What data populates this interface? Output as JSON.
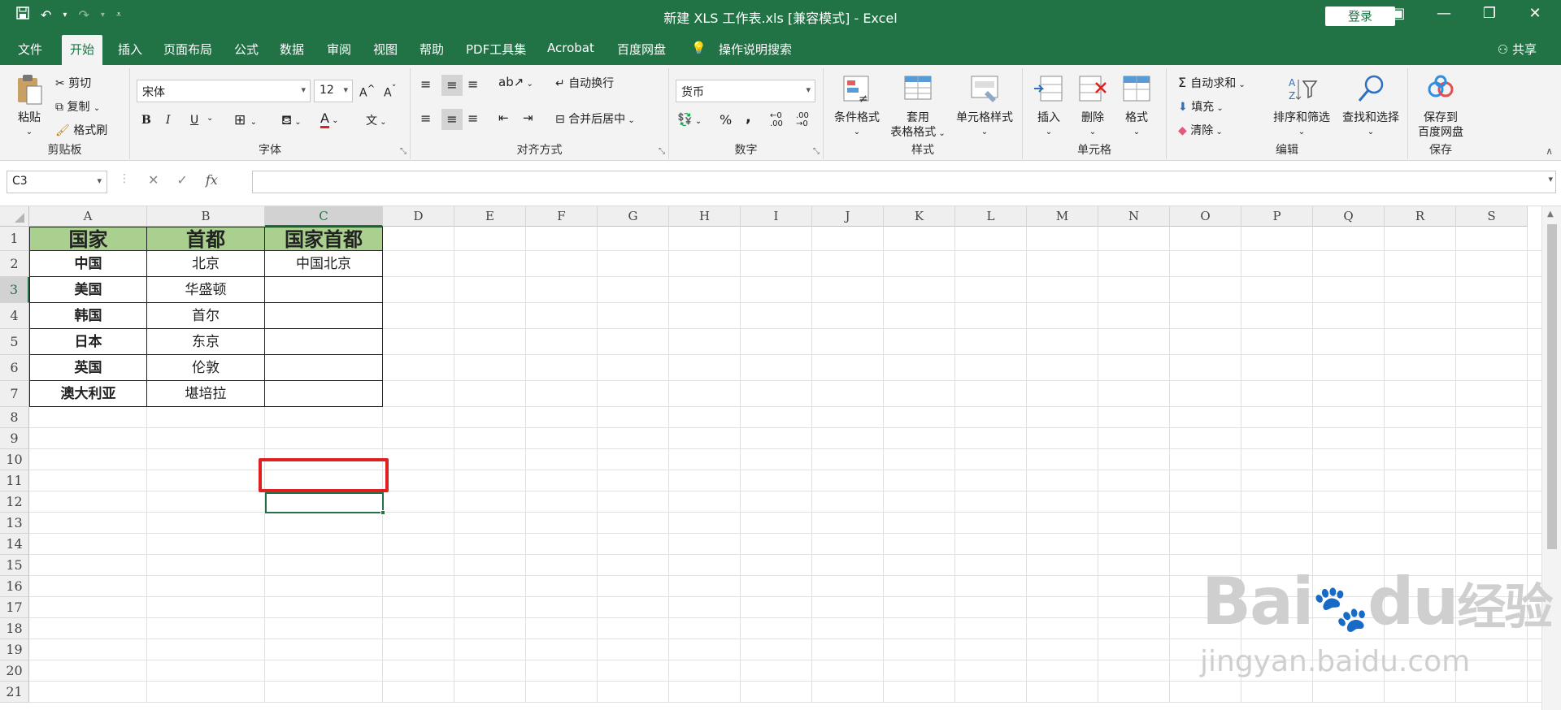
{
  "app": {
    "title": "新建 XLS 工作表.xls  [兼容模式]  -  Excel",
    "login": "登录",
    "share": "共享"
  },
  "tabs": [
    "文件",
    "开始",
    "插入",
    "页面布局",
    "公式",
    "数据",
    "审阅",
    "视图",
    "帮助",
    "PDF工具集",
    "Acrobat",
    "百度网盘",
    "操作说明搜索"
  ],
  "ribbon": {
    "clipboard": {
      "label": "剪贴板",
      "paste": "粘贴",
      "cut": "剪切",
      "copy": "复制",
      "format_painter": "格式刷"
    },
    "font": {
      "label": "字体",
      "font_name": "宋体",
      "font_size": "12",
      "bold": "B",
      "italic": "I",
      "underline": "U"
    },
    "alignment": {
      "label": "对齐方式",
      "wrap": "自动换行",
      "merge": "合并后居中"
    },
    "number": {
      "label": "数字",
      "format": "货币",
      "percent": "%",
      "comma": ","
    },
    "styles": {
      "label": "样式",
      "cond_format": "条件格式",
      "table_format_1": "套用",
      "table_format_2": "表格格式",
      "cell_style": "单元格样式"
    },
    "cells": {
      "label": "单元格",
      "insert": "插入",
      "delete": "删除",
      "format": "格式"
    },
    "editing": {
      "label": "编辑",
      "autosum": "自动求和",
      "fill": "填充",
      "clear": "清除",
      "sort_filter": "排序和筛选",
      "find_select": "查找和选择"
    },
    "save": {
      "label": "保存",
      "save_to_1": "保存到",
      "save_to_2": "百度网盘"
    }
  },
  "formula_bar": {
    "name_box": "C3",
    "formula": "",
    "fx": "fx"
  },
  "columns": [
    "A",
    "B",
    "C",
    "D",
    "E",
    "F",
    "G",
    "H",
    "I",
    "J",
    "K",
    "L",
    "M",
    "N",
    "O",
    "P",
    "Q",
    "R",
    "S"
  ],
  "rows": [
    "1",
    "2",
    "3",
    "4",
    "5",
    "6",
    "7",
    "8",
    "9",
    "10",
    "11",
    "12",
    "13",
    "14",
    "15",
    "16",
    "17",
    "18",
    "19",
    "20",
    "21"
  ],
  "sheet": {
    "header": [
      "国家",
      "首都",
      "国家首都"
    ],
    "data": [
      [
        "中国",
        "北京",
        "中国北京"
      ],
      [
        "美国",
        "华盛顿",
        ""
      ],
      [
        "韩国",
        "首尔",
        ""
      ],
      [
        "日本",
        "东京",
        ""
      ],
      [
        "英国",
        "伦敦",
        ""
      ],
      [
        "澳大利亚",
        "堪培拉",
        ""
      ]
    ]
  },
  "watermark": {
    "line1": "Bai",
    "line2": "du",
    "line3": "经验",
    "line4": "jingyan.baidu.com"
  },
  "colors": {
    "accent": "#217346",
    "header_fill": "#a9d08e",
    "highlight": "#e02020"
  }
}
